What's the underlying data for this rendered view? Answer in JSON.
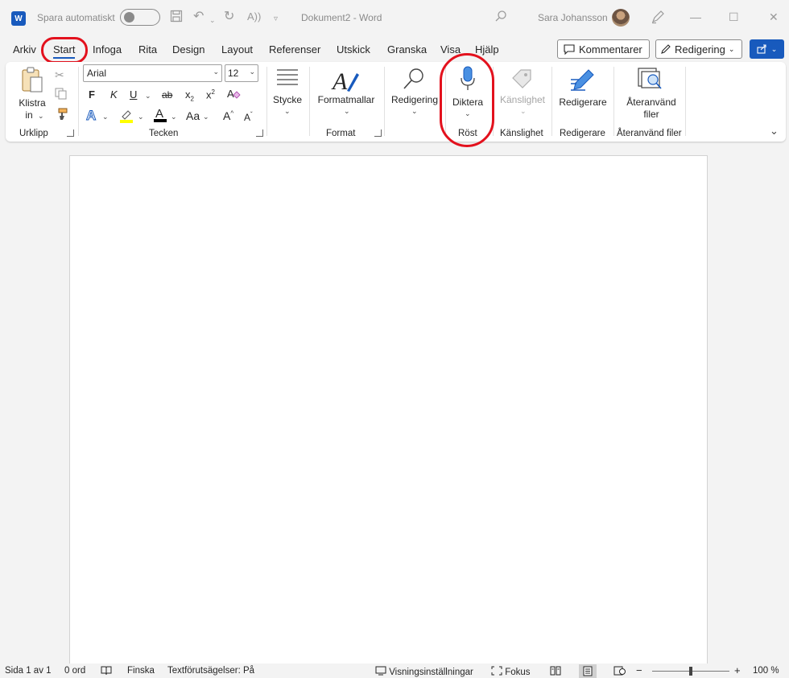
{
  "titlebar": {
    "autosave_label": "Spara automatiskt",
    "document_title": "Dokument2  -  Word",
    "user_name": "Sara Johansson"
  },
  "tabs": [
    "Arkiv",
    "Start",
    "Infoga",
    "Rita",
    "Design",
    "Layout",
    "Referenser",
    "Utskick",
    "Granska",
    "Visa",
    "Hjälp"
  ],
  "active_tab": "Start",
  "header_buttons": {
    "comments": "Kommentarer",
    "editing": "Redigering"
  },
  "ribbon": {
    "clipboard": {
      "paste_line1": "Klistra",
      "paste_line2": "in",
      "group": "Urklipp"
    },
    "font": {
      "name": "Arial",
      "size": "12",
      "bold": "F",
      "italic": "K",
      "underline": "U",
      "strike": "ab",
      "subscript": "x",
      "superscript": "x",
      "case": "Aa",
      "grow": "A",
      "shrink": "A",
      "group": "Tecken"
    },
    "paragraph": {
      "label": "Stycke"
    },
    "styles": {
      "label": "Formatmallar",
      "group": "Format"
    },
    "editing": {
      "label": "Redigering"
    },
    "voice": {
      "label": "Diktera",
      "group": "Röst"
    },
    "sensitivity": {
      "label": "Känslighet",
      "group": "Känslighet"
    },
    "editor": {
      "label": "Redigerare",
      "group": "Redigerare"
    },
    "reuse": {
      "label_line1": "Återanvänd",
      "label_line2": "filer",
      "group": "Återanvänd filer"
    }
  },
  "statusbar": {
    "page": "Sida 1 av 1",
    "words": "0 ord",
    "language": "Finska",
    "predictions": "Textförutsägelser: På",
    "display_settings": "Visningsinställningar",
    "focus": "Fokus",
    "zoom": "100 %"
  },
  "colors": {
    "accent": "#185abd",
    "highlight_circle": "#e3111d"
  }
}
